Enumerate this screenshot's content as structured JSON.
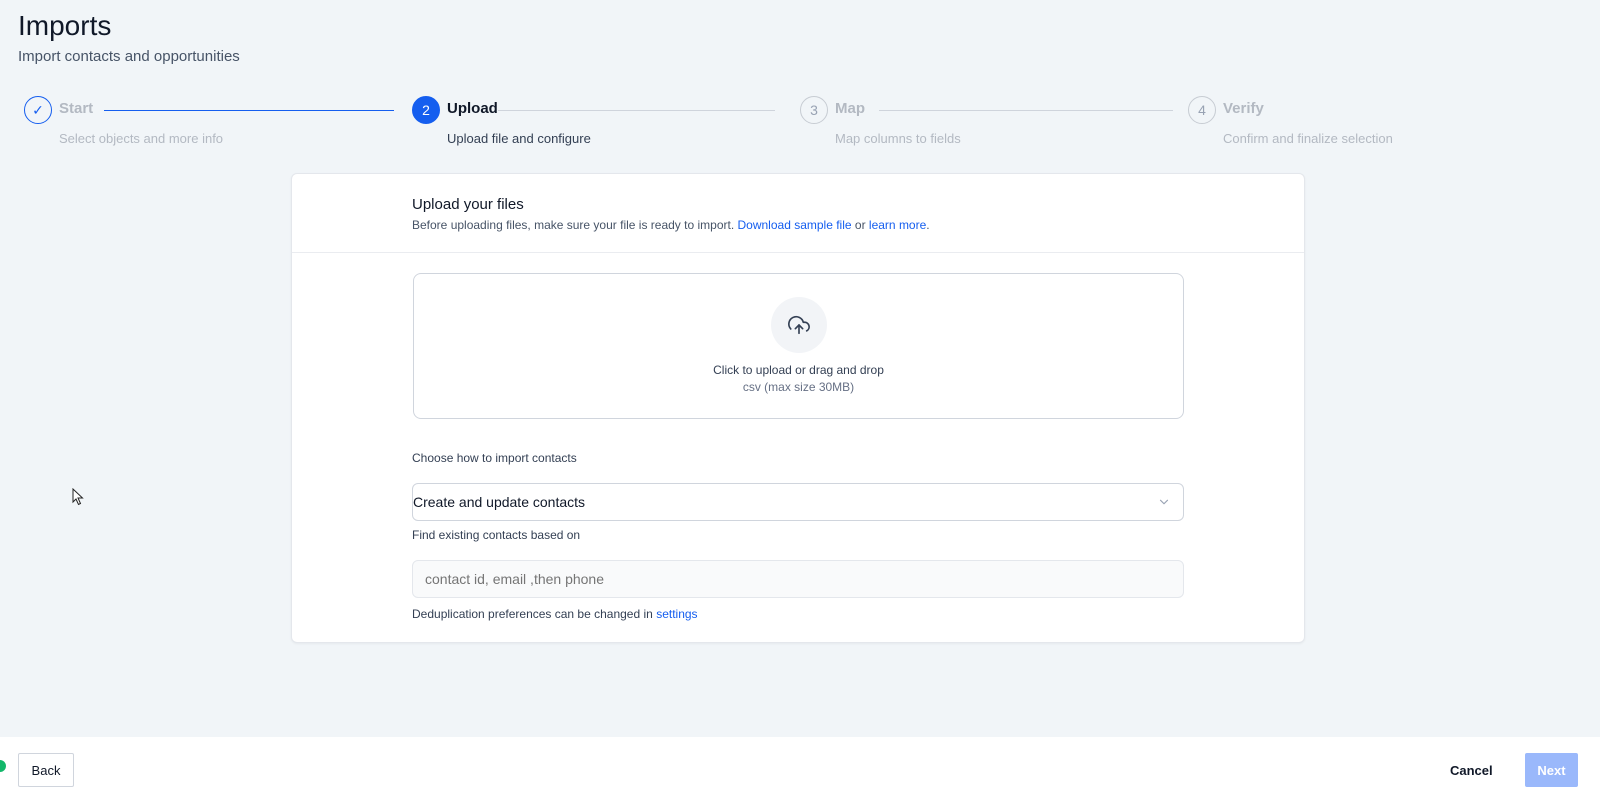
{
  "header": {
    "title": "Imports",
    "subtitle": "Import contacts and opportunities"
  },
  "steps": [
    {
      "marker": "✓",
      "title": "Start",
      "subtitle": "Select objects and more info",
      "state": "completed"
    },
    {
      "marker": "2",
      "title": "Upload",
      "subtitle": "Upload file and configure",
      "state": "active"
    },
    {
      "marker": "3",
      "title": "Map",
      "subtitle": "Map columns to fields",
      "state": "pending"
    },
    {
      "marker": "4",
      "title": "Verify",
      "subtitle": "Confirm and finalize selection",
      "state": "pending"
    }
  ],
  "upload_card": {
    "title": "Upload your files",
    "description_prefix": "Before uploading files, make sure your file is ready to import.",
    "sample_link": "Download sample file",
    "or_text": "or",
    "learn_link": "learn more",
    "period": ".",
    "dropzone": {
      "primary_text": "Click to upload or drag and drop",
      "secondary_text": "csv (max size 30MB)",
      "icon": "cloud-upload-icon"
    },
    "import_mode": {
      "label": "Choose how to import contacts",
      "selected": "Create and update contacts"
    },
    "dedupe": {
      "label": "Find existing contacts based on",
      "placeholder": "contact id, email ,then phone",
      "note_prefix": "Deduplication preferences can be changed in",
      "settings_link": "settings"
    }
  },
  "footer": {
    "back_label": "Back",
    "cancel_label": "Cancel",
    "next_label": "Next"
  },
  "colors": {
    "primary": "#155eef",
    "next_disabled": "#9ab8fb",
    "background": "#f1f5f8"
  }
}
